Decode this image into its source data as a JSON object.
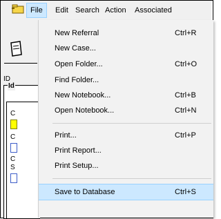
{
  "menubar": {
    "items": [
      "File",
      "Edit",
      "Search",
      "Action",
      "Associated"
    ],
    "active": "File"
  },
  "background_window": {
    "labels": [
      "ID",
      "Id",
      "C",
      "C",
      "C",
      "S"
    ]
  },
  "file_menu": {
    "items": [
      {
        "label": "New Referral",
        "shortcut": "Ctrl+R"
      },
      {
        "label": "New Case...",
        "shortcut": ""
      },
      {
        "label": "Open Folder...",
        "shortcut": "Ctrl+O"
      },
      {
        "label": "Find Folder...",
        "shortcut": ""
      },
      {
        "label": "New Notebook...",
        "shortcut": "Ctrl+B"
      },
      {
        "label": "Open Notebook...",
        "shortcut": "Ctrl+N"
      },
      {
        "label": "Print...",
        "shortcut": "Ctrl+P"
      },
      {
        "label": "Print Report...",
        "shortcut": ""
      },
      {
        "label": "Print Setup...",
        "shortcut": ""
      },
      {
        "label": "Save to Database",
        "shortcut": "Ctrl+S"
      }
    ],
    "selected": "Save to Database"
  },
  "colors": {
    "highlight": "#cce8ff",
    "highlight_border": "#99d1ff",
    "field_yellow": "#ffff00",
    "field_blue": "#3c5cc8"
  }
}
